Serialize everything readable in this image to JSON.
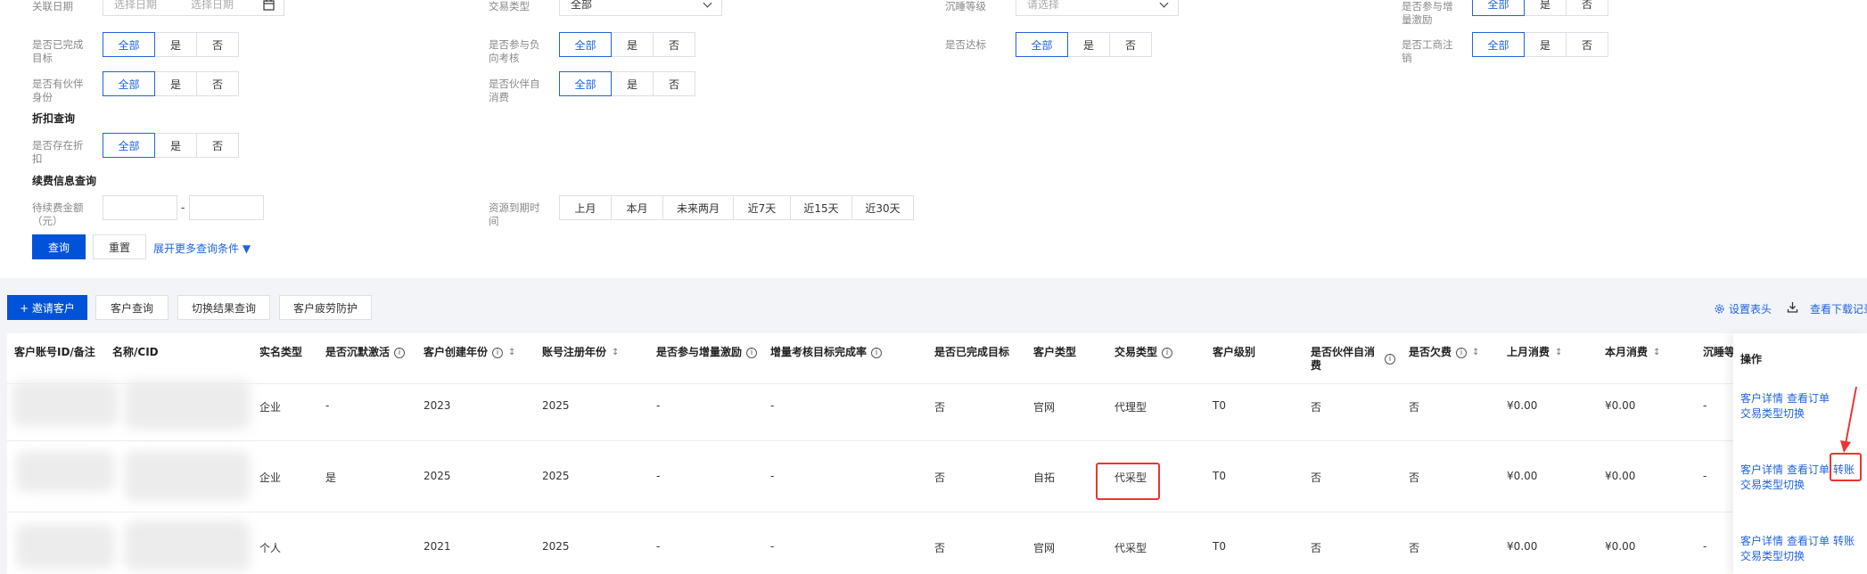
{
  "filters": {
    "row0": {
      "guanlian_label": "关联日期",
      "date_start_ph": "选择日期",
      "date_end_ph": "选择日期",
      "jiaoyi_label": "交易类型",
      "jiaoyi_value": "全部",
      "chenshui_label": "沉睡等级",
      "chenshui_ph": "请选择",
      "zengliang_label": "是否参与增量激励"
    },
    "row1": {
      "wancheng_label": "是否已完成目标",
      "fuxiang_label": "是否参与负向考核",
      "dabiao_label": "是否达标",
      "gongshang_label": "是否工商注销"
    },
    "row2": {
      "huoban_label": "是否有伙伴身份",
      "huoban_zixiaofei_label": "是否伙伴自消费"
    },
    "discount_section": "折扣查询",
    "discount_label": "是否存在折扣",
    "renewal_section": "续费信息查询",
    "renewal_amount_label": "待续费金额（元）",
    "range_sep": "-",
    "expire_label": "资源到期时间",
    "expire_options": [
      "上月",
      "本月",
      "未来两月",
      "近7天",
      "近15天",
      "近30天"
    ],
    "seg": {
      "all": "全部",
      "yes": "是",
      "no": "否"
    },
    "search_button": "查询",
    "reset_button": "重置",
    "more_link": "展开更多查询条件 ▼"
  },
  "toolbar": {
    "invite_button": "+ 邀请客户",
    "customer_query_button": "客户查询",
    "switch_result_button": "切换结果查询",
    "protect_button": "客户疲劳防护",
    "settings_link": "设置表头",
    "download_link": "查看下载记录"
  },
  "table": {
    "headers": {
      "account": "客户账号ID/备注",
      "name": "名称/CID",
      "realname": "实名类型",
      "dormant": "是否沉默激活",
      "created_year": "客户创建年份",
      "reg_year": "账号注册年份",
      "incentive": "是否参与增量激励",
      "rate": "增量考核目标完成率",
      "goal": "是否已完成目标",
      "ctype": "客户类型",
      "ttype": "交易类型",
      "level": "客户级别",
      "self": "是否伙伴自消费",
      "debt": "是否欠费",
      "last_month": "上月消费",
      "this_month": "本月消费",
      "sleep": "沉睡等",
      "ops": "操作"
    },
    "rows": [
      {
        "realname": "企业",
        "dormant": "-",
        "created_year": "2023",
        "reg_year": "2025",
        "incentive": "-",
        "rate": "-",
        "goal": "否",
        "ctype": "官网",
        "ttype": "代理型",
        "level": "T0",
        "self": "否",
        "debt": "否",
        "last_month": "¥0.00",
        "this_month": "¥0.00",
        "sleep": "-"
      },
      {
        "realname": "企业",
        "dormant": "是",
        "created_year": "2025",
        "reg_year": "2025",
        "incentive": "-",
        "rate": "-",
        "goal": "否",
        "ctype": "自拓",
        "ttype": "代采型",
        "level": "T0",
        "self": "否",
        "debt": "否",
        "last_month": "¥0.00",
        "this_month": "¥0.00",
        "sleep": "-"
      },
      {
        "realname": "个人",
        "dormant": "",
        "created_year": "2021",
        "reg_year": "2025",
        "incentive": "-",
        "rate": "-",
        "goal": "否",
        "ctype": "官网",
        "ttype": "代采型",
        "level": "T0",
        "self": "否",
        "debt": "否",
        "last_month": "¥0.00",
        "this_month": "¥0.00",
        "sleep": "-"
      }
    ],
    "ops": {
      "detail": "客户详情",
      "orders": "查看订单",
      "transfer": "转账",
      "switch": "交易类型切换"
    }
  },
  "colors": {
    "primary": "#0052d9",
    "link": "#1f63e0",
    "highlight": "#e33333"
  }
}
